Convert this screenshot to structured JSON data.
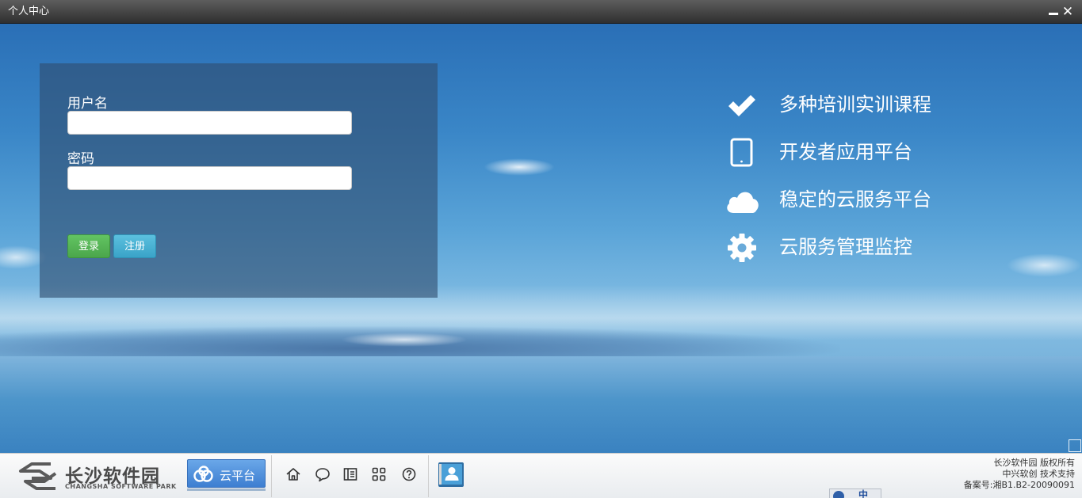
{
  "window": {
    "title": "个人中心",
    "minimize_icon": "minimize-icon",
    "close_label": "✕"
  },
  "login": {
    "username_label": "用户名",
    "username_value": "",
    "password_label": "密码",
    "password_value": "",
    "login_button": "登录",
    "register_button": "注册"
  },
  "features": [
    {
      "icon": "checkmark-icon",
      "label": "多种培训实训课程"
    },
    {
      "icon": "tablet-icon",
      "label": "开发者应用平台"
    },
    {
      "icon": "cloud-icon",
      "label": "稳定的云服务平台"
    },
    {
      "icon": "gear-icon",
      "label": "云服务管理监控"
    }
  ],
  "footer": {
    "logo_cn": "长沙软件园",
    "logo_en": "CHANGSHA SOFTWARE PARK",
    "cloud_platform_label": "云平台",
    "tools": [
      "home-icon",
      "chat-icon",
      "book-icon",
      "apps-icon",
      "help-icon"
    ],
    "user_center_icon": "user-contacts-icon",
    "copyright_lines": [
      "长沙软件园 版权所有",
      "中兴软创 技术支持",
      "备案号:湘B1.B2-20090091"
    ],
    "ime_label": "中"
  },
  "colors": {
    "titlebar": "#3a3a3a",
    "panel": "#304e70",
    "login_green": "#5cb85c",
    "register_blue": "#5bc0de",
    "cloud_button": "#4f8fdd"
  }
}
